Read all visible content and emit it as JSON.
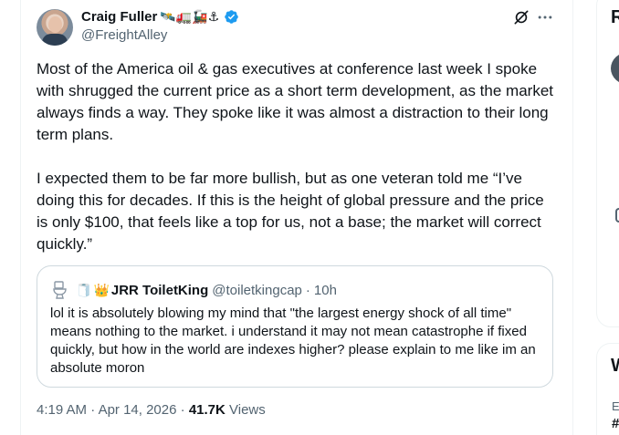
{
  "tweet": {
    "author": {
      "display_name": "Craig Fuller",
      "name_emojis": "🛰️🚛🚂⚓",
      "verified": true,
      "handle": "@FreightAlley",
      "avatar_icon": "person-avatar"
    },
    "paragraphs": [
      "Most of the America oil & gas executives at conference last week I spoke with shrugged the current price as a short term development, as the market always finds a way. They spoke like it was almost a distraction to their long term plans.",
      "I expected them to be far more bullish, but as one veteran told me “I’ve doing this for decades. If this is the height of global pressure and the price is only $100, that feels like a top for us, not a base; the market will correct quickly.”"
    ],
    "quote": {
      "avatar_icon": "toilet-icon",
      "name_emoji": "🧻",
      "badge_emoji": "👑",
      "display_name": "JRR ToiletKing",
      "handle": "@toiletkingcap",
      "separator": "·",
      "time": "10h",
      "text": "lol it is absolutely blowing my mind that \"the largest energy shock of all time\" means nothing to the market. i understand it may not mean catastrophe if fixed quickly, but how in the world are indexes higher? please explain to me like im an absolute moron"
    },
    "meta": {
      "time": "4:19 AM",
      "separator": "·",
      "date": "Apr 14, 2026",
      "views_count": "41.7K",
      "views_label": "Views"
    },
    "icons": {
      "grok": "grok-icon",
      "more": "more-icon",
      "verified_color": "#1d9bf0"
    }
  },
  "sidebar_right": {
    "card1_heading_fragment": "R",
    "card2_heading_fragment": "W",
    "card2_sub_fragment": "E",
    "card2_tag_fragment": "#"
  }
}
